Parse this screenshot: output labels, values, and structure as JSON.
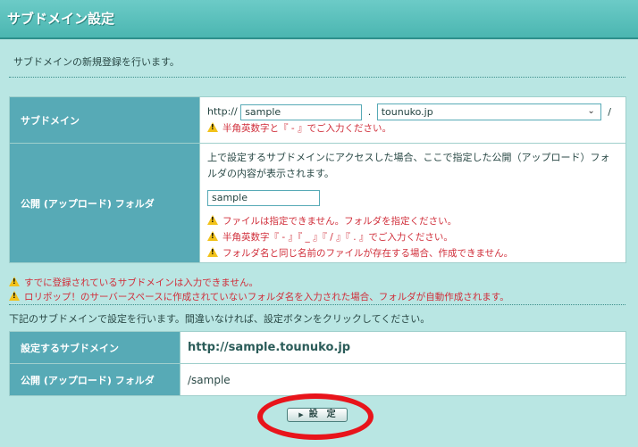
{
  "header": {
    "title": "サブドメイン設定"
  },
  "intro": "サブドメインの新規登録を行います。",
  "form": {
    "subdomain": {
      "label": "サブドメイン",
      "prefix": "http://",
      "value": "sample",
      "dot": ".",
      "domain_selected": "tounuko.jp",
      "suffix": "/",
      "warning": "半角英数字と『 - 』でご入力ください。"
    },
    "folder": {
      "label": "公開 (アップロード) フォルダ",
      "description": "上で設定するサブドメインにアクセスした場合、ここで指定した公開（アップロード）フォルダの内容が表示されます。",
      "value": "sample",
      "warnings": [
        "ファイルは指定できません。フォルダを指定ください。",
        "半角英数字『 - 』『 _ 』『 / 』『 . 』でご入力ください。",
        "フォルダ名と同じ名前のファイルが存在する場合、作成できません。"
      ]
    }
  },
  "notes": [
    "すでに登録されているサブドメインは入力できません。",
    "ロリポップ！のサーバースペースに作成されていないフォルダ名を入力された場合、フォルダが自動作成されます。"
  ],
  "confirm_text": "下記のサブドメインで設定を行います。間違いなければ、設定ボタンをクリックしてください。",
  "result": {
    "subdomain_label": "設定するサブドメイン",
    "subdomain_value": "http://sample.tounuko.jp",
    "folder_label": "公開 (アップロード) フォルダ",
    "folder_value": "/sample"
  },
  "submit_label": "設　定",
  "icons": {
    "warning": "warning-triangle-icon",
    "button_arrow": "arrow-right-icon",
    "select_chevron": "chevron-down-icon"
  },
  "colors": {
    "header": "#4bb6b1",
    "label_bg": "#57aab6",
    "warning": "#d02e3a",
    "highlight_circle": "#e8141b"
  }
}
